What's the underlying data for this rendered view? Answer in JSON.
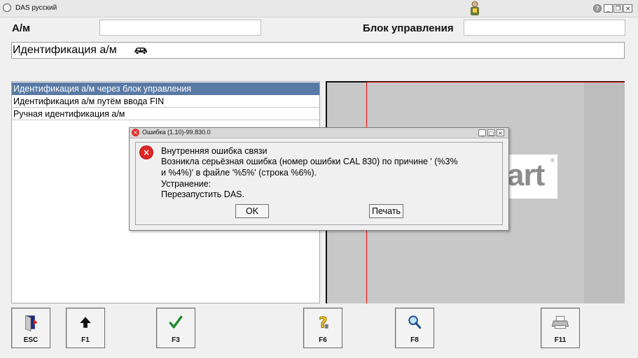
{
  "window": {
    "title": "DAS русский",
    "controls": {
      "help": "?",
      "minimize": "_",
      "restore": "❐",
      "close": "×"
    }
  },
  "header": {
    "vehicle_label": "А/м",
    "vehicle_value": "",
    "control_unit_label": "Блок управления",
    "control_unit_value": ""
  },
  "section": {
    "title": "Идентификация а/м",
    "icon": "car-icon"
  },
  "list": {
    "items": [
      {
        "label": "Идентификация а/м через блок управления",
        "selected": true
      },
      {
        "label": "Идентификация а/м путём ввода FIN",
        "selected": false
      },
      {
        "label": "Ручная идентификация а/м",
        "selected": false
      }
    ]
  },
  "panel": {
    "logo_text": "art",
    "logo_reg": "®"
  },
  "dialog": {
    "title": "Ошибка  (1.10)-99.830.0",
    "controls": {
      "minimize": "_",
      "maximize": "□",
      "close": "×"
    },
    "lines": [
      "Внутренняя ошибка связи",
      "Возникла серьёзная ошибка (номер ошибки CAL 830) по причине ' (%3%",
      "и %4%)' в файле '%5%' (строка %6%).",
      "Устранение:",
      "Перезапустить DAS."
    ],
    "ok_label": "OK",
    "print_label": "Печать"
  },
  "function_keys": [
    {
      "label": "ESC",
      "icon": "exit-door-icon"
    },
    {
      "label": "F1",
      "icon": "up-arrow-icon"
    },
    {
      "label": "F3",
      "icon": "checkmark-icon"
    },
    {
      "label": "F6",
      "icon": "help-question-icon"
    },
    {
      "label": "F8",
      "icon": "magnifier-icon"
    },
    {
      "label": "F11",
      "icon": "printer-icon"
    }
  ],
  "colors": {
    "selection": "#5a7aa6",
    "error_red": "#e02424",
    "panel_gray": "#c8c8c8"
  }
}
